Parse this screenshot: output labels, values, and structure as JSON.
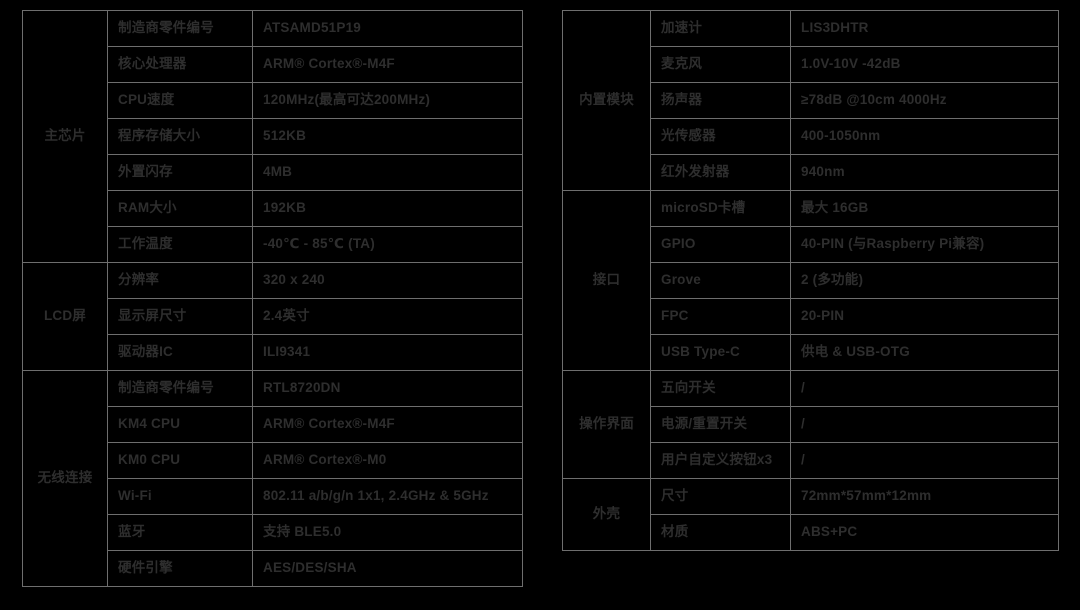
{
  "colors": {
    "background": "#000000",
    "border": "#6e6e6e",
    "text": "#2e2e2e"
  },
  "tables": [
    {
      "id": "left",
      "groups": [
        {
          "label": "主芯片",
          "rows": [
            {
              "name": "制造商零件编号",
              "value": "ATSAMD51P19"
            },
            {
              "name": "核心处理器",
              "value": "ARM® Cortex®-M4F"
            },
            {
              "name": "CPU速度",
              "value": "120MHz(最高可达200MHz)"
            },
            {
              "name": "程序存储大小",
              "value": "512KB"
            },
            {
              "name": "外置闪存",
              "value": "4MB"
            },
            {
              "name": "RAM大小",
              "value": "192KB"
            },
            {
              "name": "工作温度",
              "value": "-40℃ - 85℃ (TA)"
            }
          ]
        },
        {
          "label": "LCD屏",
          "rows": [
            {
              "name": "分辨率",
              "value": "320 x 240"
            },
            {
              "name": "显示屏尺寸",
              "value": "2.4英寸"
            },
            {
              "name": "驱动器IC",
              "value": "ILI9341"
            }
          ]
        },
        {
          "label": "无线连接",
          "rows": [
            {
              "name": "制造商零件编号",
              "value": "RTL8720DN"
            },
            {
              "name": "KM4 CPU",
              "value": "ARM® Cortex®-M4F"
            },
            {
              "name": "KM0 CPU",
              "value": "ARM® Cortex®-M0"
            },
            {
              "name": "Wi-Fi",
              "value": "802.11 a/b/g/n 1x1, 2.4GHz & 5GHz"
            },
            {
              "name": "蓝牙",
              "value": "支持 BLE5.0"
            },
            {
              "name": "硬件引擎",
              "value": "AES/DES/SHA"
            }
          ]
        }
      ]
    },
    {
      "id": "right",
      "groups": [
        {
          "label": "内置模块",
          "rows": [
            {
              "name": "加速计",
              "value": "LIS3DHTR"
            },
            {
              "name": "麦克风",
              "value": "1.0V-10V -42dB"
            },
            {
              "name": "扬声器",
              "value": "≥78dB @10cm 4000Hz"
            },
            {
              "name": "光传感器",
              "value": "400-1050nm"
            },
            {
              "name": "红外发射器",
              "value": "940nm"
            }
          ]
        },
        {
          "label": "接口",
          "rows": [
            {
              "name": "microSD卡槽",
              "value": "最大 16GB"
            },
            {
              "name": "GPIO",
              "value": "40-PIN (与Raspberry Pi兼容)"
            },
            {
              "name": "Grove",
              "value": "2 (多功能)"
            },
            {
              "name": "FPC",
              "value": "20-PIN"
            },
            {
              "name": "USB Type-C",
              "value": "供电 & USB-OTG"
            }
          ]
        },
        {
          "label": "操作界面",
          "rows": [
            {
              "name": "五向开关",
              "value": "/"
            },
            {
              "name": "电源/重置开关",
              "value": "/"
            },
            {
              "name": "用户自定义按钮x3",
              "value": "/"
            }
          ]
        },
        {
          "label": "外壳",
          "rows": [
            {
              "name": "尺寸",
              "value": "72mm*57mm*12mm"
            },
            {
              "name": "材质",
              "value": "ABS+PC"
            }
          ]
        }
      ]
    }
  ]
}
